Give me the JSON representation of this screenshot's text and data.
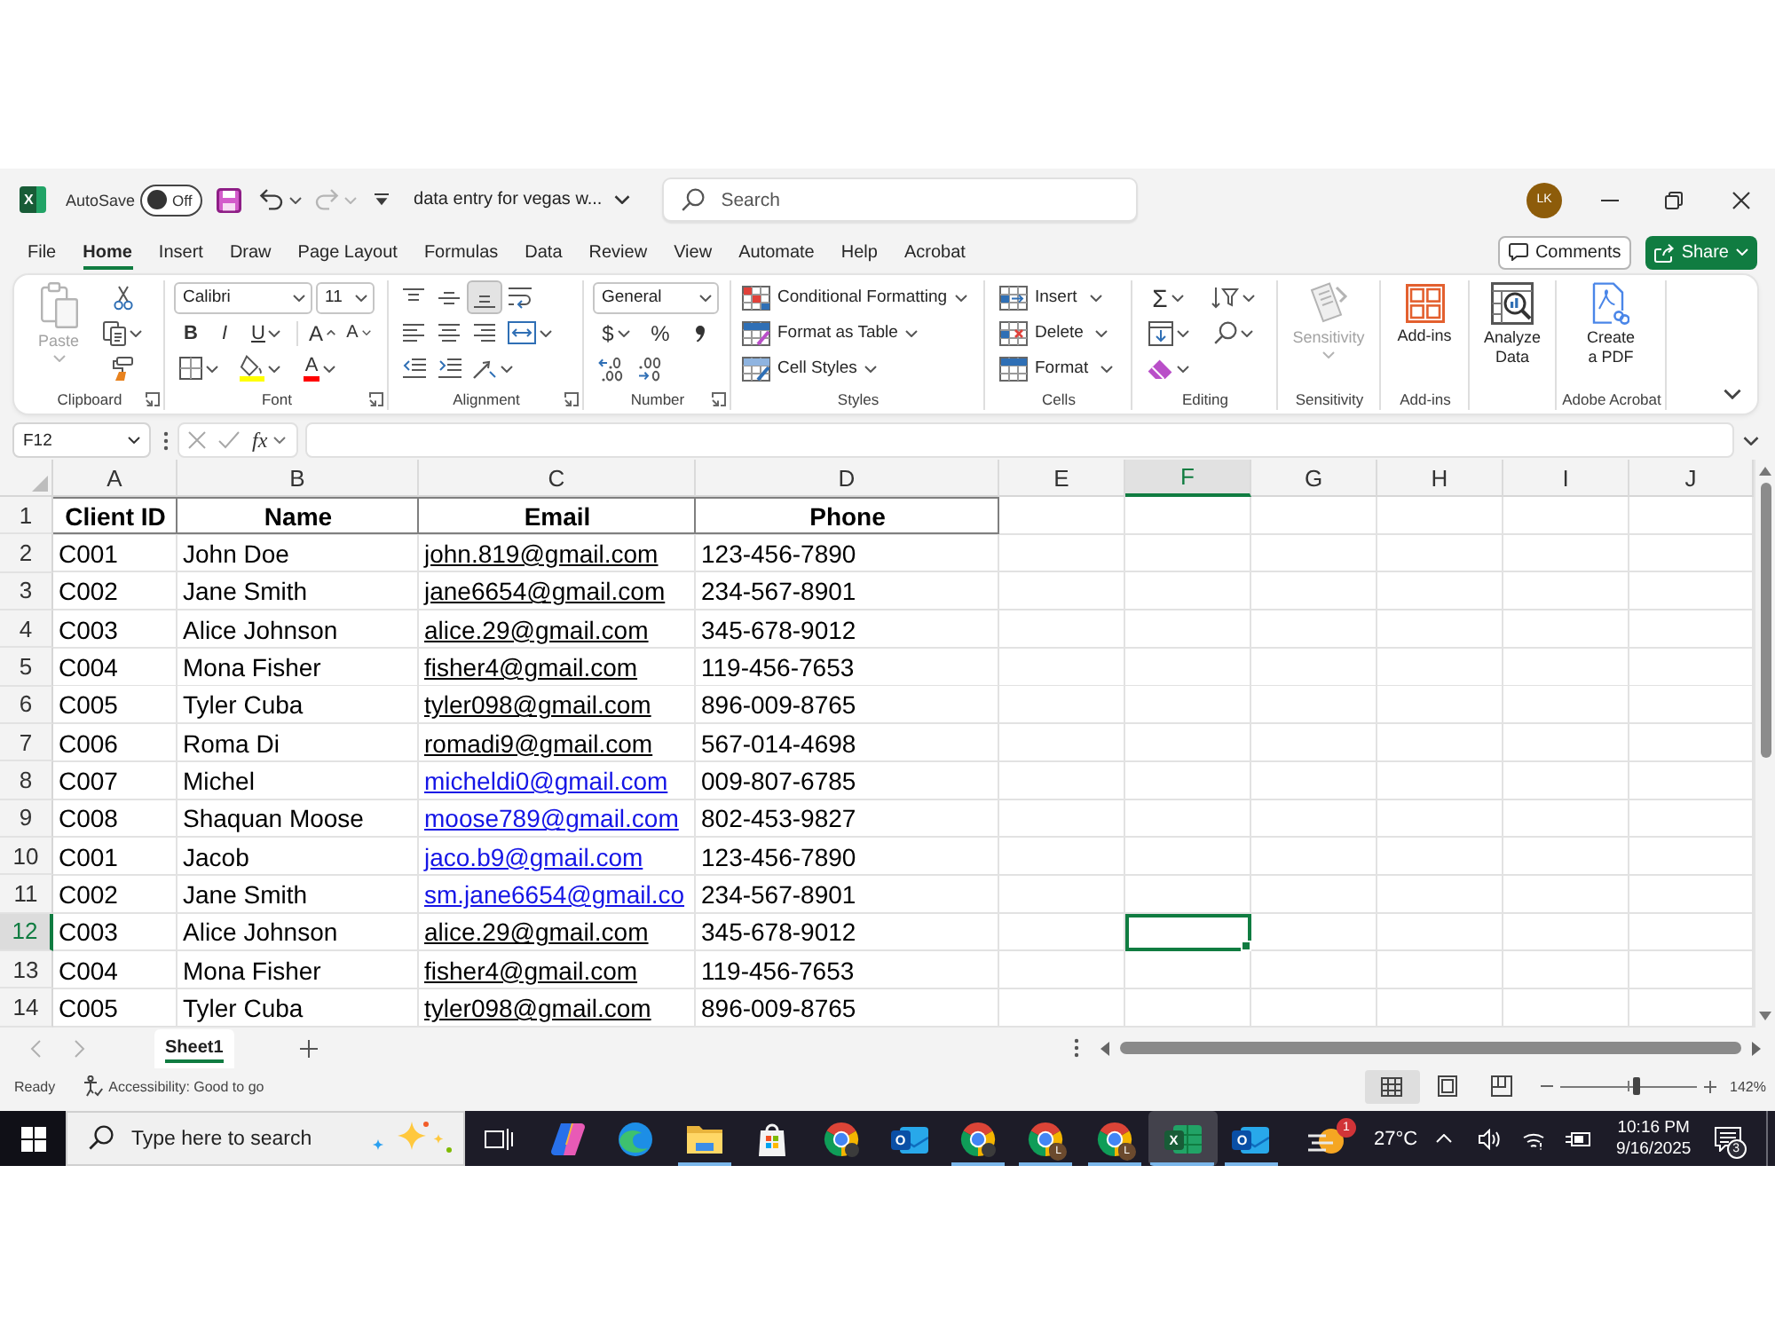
{
  "title_bar": {
    "app_logo_letter": "X",
    "autosave_label": "AutoSave",
    "autosave_on": false,
    "autosave_state": "Off",
    "redo_disabled": true,
    "document_title": "data entry for vegas w...",
    "search_placeholder": "Search",
    "avatar_initials": "LK"
  },
  "menu_tabs": [
    {
      "label": "File",
      "selected": false
    },
    {
      "label": "Home",
      "selected": true
    },
    {
      "label": "Insert",
      "selected": false
    },
    {
      "label": "Draw",
      "selected": false
    },
    {
      "label": "Page Layout",
      "selected": false
    },
    {
      "label": "Formulas",
      "selected": false
    },
    {
      "label": "Data",
      "selected": false
    },
    {
      "label": "Review",
      "selected": false
    },
    {
      "label": "View",
      "selected": false
    },
    {
      "label": "Automate",
      "selected": false
    },
    {
      "label": "Help",
      "selected": false
    },
    {
      "label": "Acrobat",
      "selected": false
    }
  ],
  "comments_button": "Comments",
  "share_button": "Share",
  "ribbon": {
    "clipboard": {
      "paste": "Paste",
      "paste_disabled": true,
      "label": "Clipboard"
    },
    "font": {
      "font_name": "Calibri",
      "font_size": "11",
      "bold": "B",
      "italic": "I",
      "underline": "U",
      "grow_font": "A",
      "shrink_font": "A",
      "font_color": "A",
      "label": "Font"
    },
    "alignment": {
      "vertical": [
        {
          "kind": "top",
          "selected": false
        },
        {
          "kind": "middle",
          "selected": false
        },
        {
          "kind": "bottom",
          "selected": true
        }
      ],
      "horizontal": [
        {
          "kind": "left",
          "selected": false
        },
        {
          "kind": "center",
          "selected": false
        },
        {
          "kind": "right",
          "selected": false
        }
      ],
      "label": "Alignment"
    },
    "number": {
      "format": "General",
      "currency": "$",
      "percent": "%",
      "label": "Number"
    },
    "styles": {
      "items": [
        "Conditional Formatting",
        "Format as Table",
        "Cell Styles"
      ],
      "label": "Styles"
    },
    "cells": {
      "items": [
        "Insert",
        "Delete",
        "Format"
      ],
      "label": "Cells"
    },
    "editing": {
      "autosum": "Σ",
      "label": "Editing"
    },
    "sensitivity": {
      "button": "Sensitivity",
      "disabled": true,
      "label": "Sensitivity"
    },
    "add_ins": {
      "button": "Add-ins",
      "label": "Add-ins"
    },
    "analyze_data": {
      "button": "Analyze Data"
    },
    "adobe_acrobat": {
      "button": "Create a PDF",
      "label": "Adobe Acrobat"
    }
  },
  "formula_bar": {
    "name_box": "F12",
    "function_label": "fx"
  },
  "grid": {
    "columns": [
      {
        "label": "A",
        "selected": false
      },
      {
        "label": "B",
        "selected": false
      },
      {
        "label": "C",
        "selected": false
      },
      {
        "label": "D",
        "selected": false
      },
      {
        "label": "E",
        "selected": false
      },
      {
        "label": "F",
        "selected": true
      },
      {
        "label": "G",
        "selected": false
      },
      {
        "label": "H",
        "selected": false
      },
      {
        "label": "I",
        "selected": false
      },
      {
        "label": "J",
        "selected": false
      }
    ],
    "header_row": {
      "number": "1",
      "selected": false,
      "cells": [
        "Client ID",
        "Name",
        "Email",
        "Phone"
      ]
    },
    "rows": [
      {
        "number": "2",
        "selected": false,
        "client_id": "C001",
        "name": "John Doe",
        "email": {
          "text": "john.819@gmail.com",
          "color": "#000000"
        },
        "phone": "123-456-7890"
      },
      {
        "number": "3",
        "selected": false,
        "client_id": "C002",
        "name": "Jane Smith",
        "email": {
          "text": "jane6654@gmail.com",
          "color": "#000000"
        },
        "phone": "234-567-8901"
      },
      {
        "number": "4",
        "selected": false,
        "client_id": "C003",
        "name": "Alice Johnson",
        "email": {
          "text": "alice.29@gmail.com",
          "color": "#000000"
        },
        "phone": "345-678-9012"
      },
      {
        "number": "5",
        "selected": false,
        "client_id": "C004",
        "name": "Mona Fisher",
        "email": {
          "text": "fisher4@gmail.com",
          "color": "#000000"
        },
        "phone": "119-456-7653"
      },
      {
        "number": "6",
        "selected": false,
        "client_id": "C005",
        "name": "Tyler Cuba",
        "email": {
          "text": "tyler098@gmail.com",
          "color": "#000000"
        },
        "phone": "896-009-8765"
      },
      {
        "number": "7",
        "selected": false,
        "client_id": "C006",
        "name": "Roma Di",
        "email": {
          "text": "romadi9@gmail.com",
          "color": "#000000"
        },
        "phone": "567-014-4698"
      },
      {
        "number": "8",
        "selected": false,
        "client_id": "C007",
        "name": "Michel",
        "email": {
          "text": "micheldi0@gmail.com",
          "color": "#1515e6"
        },
        "phone": "009-807-6785"
      },
      {
        "number": "9",
        "selected": false,
        "client_id": "C008",
        "name": "Shaquan Moose",
        "email": {
          "text": "moose789@gmail.com",
          "color": "#1515e6"
        },
        "phone": "802-453-9827"
      },
      {
        "number": "10",
        "selected": false,
        "client_id": "C001",
        "name": "Jacob",
        "email": {
          "text": "jaco.b9@gmail.com",
          "color": "#1515e6"
        },
        "phone": "123-456-7890"
      },
      {
        "number": "11",
        "selected": false,
        "client_id": "C002",
        "name": "Jane Smith",
        "email": {
          "text": "sm.jane6654@gmail.co",
          "color": "#1515e6"
        },
        "phone": "234-567-8901"
      },
      {
        "number": "12",
        "selected": true,
        "client_id": "C003",
        "name": "Alice Johnson",
        "email": {
          "text": "alice.29@gmail.com",
          "color": "#000000"
        },
        "phone": "345-678-9012"
      },
      {
        "number": "13",
        "selected": false,
        "client_id": "C004",
        "name": "Mona Fisher",
        "email": {
          "text": "fisher4@gmail.com",
          "color": "#000000"
        },
        "phone": "119-456-7653"
      },
      {
        "number": "14",
        "selected": false,
        "client_id": "C005",
        "name": "Tyler Cuba",
        "email": {
          "text": "tyler098@gmail.com",
          "color": "#000000"
        },
        "phone": "896-009-8765"
      }
    ]
  },
  "sheet_tabs": [
    {
      "label": "Sheet1",
      "selected": true
    }
  ],
  "status_bar": {
    "mode": "Ready",
    "accessibility": "Accessibility: Good to go",
    "views": [
      {
        "kind": "normal",
        "selected": true
      },
      {
        "kind": "page_layout",
        "selected": false
      },
      {
        "kind": "page_break",
        "selected": false
      }
    ],
    "zoom": {
      "level": 0.56,
      "reading": "142%"
    }
  },
  "taskbar": {
    "search_placeholder": "Type here to search",
    "apps": [
      {
        "kind": "task_view",
        "running": false,
        "selected": false
      },
      {
        "kind": "assistant",
        "running": false,
        "selected": false
      },
      {
        "kind": "wave_browser",
        "running": false,
        "selected": false
      },
      {
        "kind": "folder",
        "running": true,
        "selected": false
      },
      {
        "kind": "store",
        "running": false,
        "selected": false
      },
      {
        "kind": "ring_browser",
        "running": false,
        "selected": false
      },
      {
        "kind": "mail",
        "letter": "O",
        "running": false,
        "selected": false
      },
      {
        "kind": "ring_browser",
        "running": true,
        "selected": false
      },
      {
        "kind": "ring_browser",
        "profile_letter": "L",
        "running": true,
        "selected": false
      },
      {
        "kind": "ring_browser",
        "profile_letter": "L",
        "running": true,
        "selected": false
      },
      {
        "kind": "spreadsheet",
        "letter": "X",
        "running": true,
        "selected": true
      },
      {
        "kind": "mail",
        "letter": "O",
        "running": true,
        "selected": false
      }
    ],
    "weather": {
      "badge": "1",
      "temperature": "27°C"
    },
    "time": "10:16 PM",
    "date": "9/16/2025",
    "notification_count": "3"
  }
}
